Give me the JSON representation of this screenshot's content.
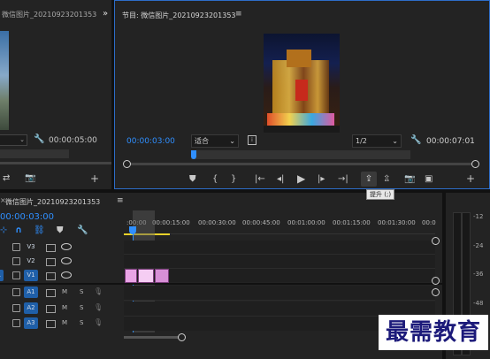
{
  "source_monitor": {
    "title": "微信图片_20210923201353",
    "timecode": "00:00:05:00",
    "more_label": "»"
  },
  "program_monitor": {
    "title": "节目: 微信图片_20210923201353",
    "menu_label": "≡",
    "timecode_left": "00:00:03:00",
    "fit_label": "适合",
    "resolution_label": "1/2",
    "timecode_right": "00:00:07:01",
    "tooltip": "提升 (;)"
  },
  "timeline": {
    "title": "微信图片_20210923201353",
    "close_label": "×",
    "menu_label": "≡",
    "timecode": "00:00:03:00",
    "ruler_labels": [
      ":00:00",
      "00:00:15:00",
      "00:00:30:00",
      "00:00:45:00",
      "00:01:00:00",
      "00:01:15:00",
      "00:01:30:00",
      "00:0"
    ],
    "tracks": [
      {
        "name": "V3",
        "type": "video"
      },
      {
        "name": "V2",
        "type": "video"
      },
      {
        "name": "V1",
        "type": "video",
        "source": "1"
      },
      {
        "name": "A1",
        "type": "audio",
        "m": "M",
        "s": "S"
      },
      {
        "name": "A2",
        "type": "audio",
        "m": "M",
        "s": "S"
      },
      {
        "name": "A3",
        "type": "audio",
        "m": "M",
        "s": "S"
      }
    ]
  },
  "audio_meter": {
    "labels": [
      "-12",
      "-24",
      "-36",
      "-48"
    ]
  },
  "watermark": "最需教育",
  "colors": {
    "accent_blue": "#2f8fff",
    "clip_pink": "#e9a4e6",
    "clip_light": "#f5cdf3",
    "yellow_range": "#e8d22a"
  }
}
